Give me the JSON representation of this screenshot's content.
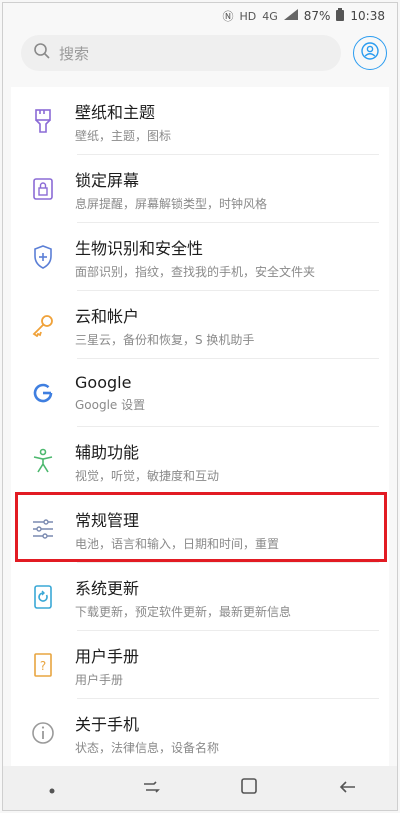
{
  "status_bar": {
    "battery": "87%",
    "time": "10:38",
    "network": "4G"
  },
  "search": {
    "placeholder": "搜索"
  },
  "settings": {
    "items": [
      {
        "title": "壁纸和主题",
        "subtitle": "壁纸，主题，图标",
        "icon": "brush-icon"
      },
      {
        "title": "锁定屏幕",
        "subtitle": "息屏提醒，屏幕解锁类型，时钟风格",
        "icon": "lock-icon"
      },
      {
        "title": "生物识别和安全性",
        "subtitle": "面部识别，指纹，查找我的手机，安全文件夹",
        "icon": "shield-icon"
      },
      {
        "title": "云和帐户",
        "subtitle": "三星云，备份和恢复，S 换机助手",
        "icon": "key-icon"
      },
      {
        "title": "Google",
        "subtitle": "Google 设置",
        "icon": "google-icon"
      },
      {
        "title": "辅助功能",
        "subtitle": "视觉，听觉，敏捷度和互动",
        "icon": "accessibility-icon"
      },
      {
        "title": "常规管理",
        "subtitle": "电池，语言和输入，日期和时间，重置",
        "icon": "sliders-icon"
      },
      {
        "title": "系统更新",
        "subtitle": "下载更新，预定软件更新，最新更新信息",
        "icon": "update-icon"
      },
      {
        "title": "用户手册",
        "subtitle": "用户手册",
        "icon": "manual-icon"
      },
      {
        "title": "关于手机",
        "subtitle": "状态，法律信息，设备名称",
        "icon": "info-icon"
      }
    ]
  },
  "colors": {
    "highlight": "#e21b23",
    "accent_blue": "#2b9cf0"
  }
}
